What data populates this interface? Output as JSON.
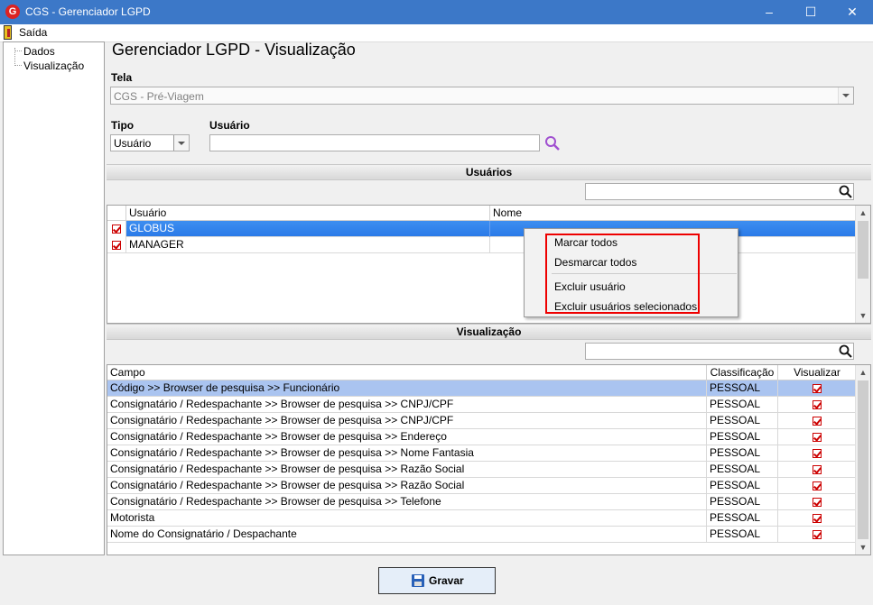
{
  "window": {
    "title": "CGS - Gerenciador LGPD",
    "app_icon": "G",
    "minimize": "–",
    "maximize": "☐",
    "close": "✕"
  },
  "menu": {
    "exit_label": "Saída"
  },
  "tree": {
    "items": [
      "Dados",
      "Visualização"
    ]
  },
  "page": {
    "title": "Gerenciador LGPD - Visualização"
  },
  "form": {
    "tela_label": "Tela",
    "tela_value": "CGS - Pré-Viagem",
    "tipo_label": "Tipo",
    "tipo_value": "Usuário",
    "usuario_label": "Usuário",
    "usuario_value": ""
  },
  "users_section": {
    "title": "Usuários",
    "filter_value": "",
    "columns": [
      "Usuário",
      "Nome"
    ],
    "rows": [
      {
        "usuario": "GLOBUS",
        "nome": "",
        "checked": true,
        "selected": true
      },
      {
        "usuario": "MANAGER",
        "nome": "",
        "checked": true,
        "selected": false
      }
    ]
  },
  "context_menu": {
    "items": [
      "Marcar todos",
      "Desmarcar todos",
      "Excluir usuário",
      "Excluir usuários selecionados"
    ]
  },
  "view_section": {
    "title": "Visualização",
    "filter_value": "",
    "columns": [
      "Campo",
      "Classificação",
      "Visualizar"
    ],
    "rows": [
      {
        "campo": "Código >> Browser de pesquisa >> Funcionário",
        "classificacao": "PESSOAL",
        "visualizar": true
      },
      {
        "campo": "Consignatário / Redespachante >> Browser de pesquisa >> CNPJ/CPF",
        "classificacao": "PESSOAL",
        "visualizar": true
      },
      {
        "campo": "Consignatário / Redespachante >> Browser de pesquisa >> CNPJ/CPF",
        "classificacao": "PESSOAL",
        "visualizar": true
      },
      {
        "campo": "Consignatário / Redespachante >> Browser de pesquisa >> Endereço",
        "classificacao": "PESSOAL",
        "visualizar": true
      },
      {
        "campo": "Consignatário / Redespachante >> Browser de pesquisa >> Nome Fantasia",
        "classificacao": "PESSOAL",
        "visualizar": true
      },
      {
        "campo": "Consignatário / Redespachante >> Browser de pesquisa >> Razão Social",
        "classificacao": "PESSOAL",
        "visualizar": true
      },
      {
        "campo": "Consignatário / Redespachante >> Browser de pesquisa >> Razão Social",
        "classificacao": "PESSOAL",
        "visualizar": true
      },
      {
        "campo": "Consignatário / Redespachante >> Browser de pesquisa >> Telefone",
        "classificacao": "PESSOAL",
        "visualizar": true
      },
      {
        "campo": "Motorista",
        "classificacao": "PESSOAL",
        "visualizar": true
      },
      {
        "campo": "Nome do Consignatário / Despachante",
        "classificacao": "PESSOAL",
        "visualizar": true
      }
    ]
  },
  "actions": {
    "save_label": "Gravar"
  },
  "colors": {
    "titlebar": "#3c78c8",
    "selection": "#2a7ae8",
    "highlight": "#e00000"
  }
}
